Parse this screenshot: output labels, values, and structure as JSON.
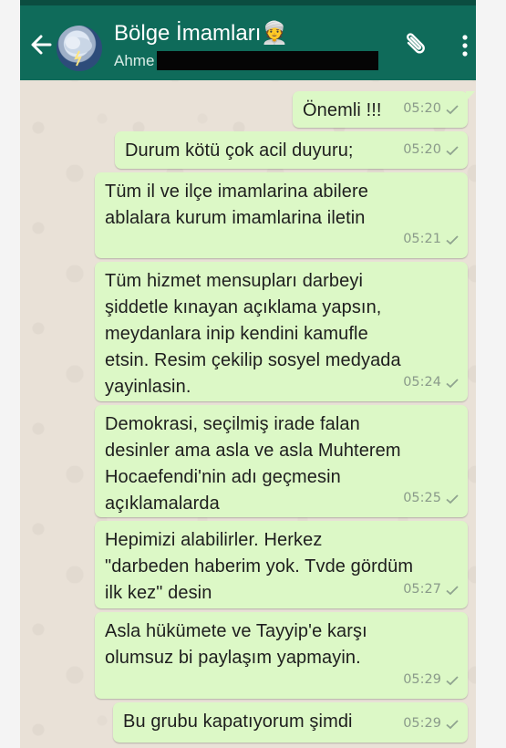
{
  "header": {
    "title": "Bölge İmamları👳",
    "subtitle": "Ahme"
  },
  "messages": [
    {
      "text": "Önemli !!!",
      "time": "05:20"
    },
    {
      "text": "Durum kötü çok acil duyuru;",
      "time": "05:20"
    },
    {
      "text": "Tüm il ve ilçe imamlarina abilere\nablalara kurum imamlarina iletin",
      "time": "05:21"
    },
    {
      "text": "Tüm hizmet mensupları darbeyi\nşiddetle kınayan açıklama yapsın,\nmeydanlara inip kendini kamufle\netsin. Resim çekilip sosyel medyada\nyayinlasin.",
      "time": "05:24"
    },
    {
      "text": "Demokrasi, seçilmiş irade falan\ndesinler ama asla ve asla Muhterem\nHocaefendi'nin adı geçmesin\naçıklamalarda",
      "time": "05:25"
    },
    {
      "text": "Hepimizi alabilirler. Herkez\n\"darbeden haberim yok. Tvde gördüm\nilk kez\" desin",
      "time": "05:27"
    },
    {
      "text": "Asla hükümete ve Tayyip'e karşı\nolumsuz bi paylaşım yapmayin.",
      "time": "05:29"
    },
    {
      "text": "Bu grubu kapatıyorum şimdi",
      "time": "05:29"
    }
  ],
  "colors": {
    "header": "#0f6b5a",
    "bubble_outgoing": "#dcf8c6",
    "chat_background": "#e9e1d7"
  },
  "icons": {
    "back": "arrow-left-icon",
    "attach": "paperclip-icon",
    "menu": "more-vert-icon",
    "status": "single-check-icon"
  }
}
